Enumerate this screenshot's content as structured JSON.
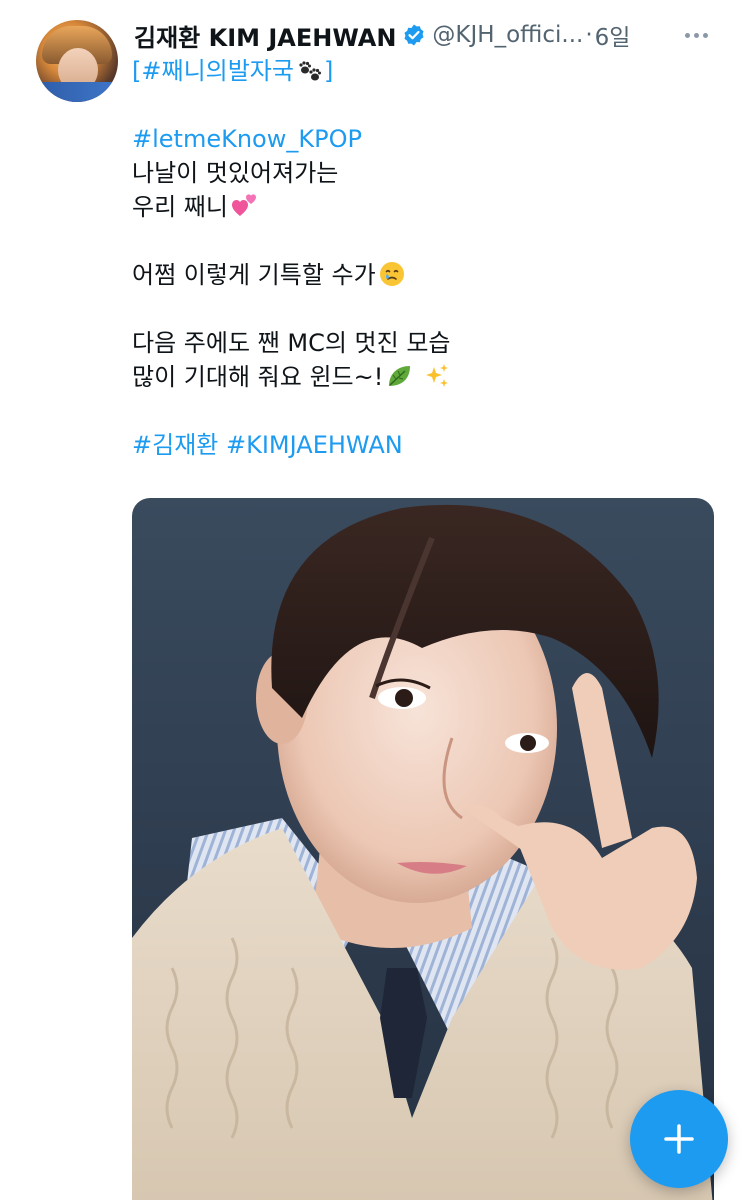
{
  "tweet": {
    "author_name": "김재환 KIM JAEHWAN",
    "handle": "@KJH_offici...",
    "separator": "·",
    "time": "6일",
    "lines": {
      "l1_bracket_open": "[",
      "l1_hashtag": "#째니의발자국",
      "l1_bracket_close": "]",
      "l2_hashtag": "#letmeKnow_KPOP",
      "l3": "나날이 멋있어져가는",
      "l4": "우리 째니",
      "l5": "어쩜 이렇게 기특할 수가",
      "l6": "다음 주에도 짼 MC의 멋진 모습",
      "l7": "많이 기대해 줘요 윈드~!",
      "l8_tag1": "#김재환",
      "l8_tag2": "#KIMJAEHWAN"
    }
  },
  "icons": {
    "verified": "verified-badge-icon",
    "more": "more-options-icon",
    "paw": "paw-prints-icon",
    "hearts": "two-hearts-icon",
    "teary_face": "face-holding-back-tears-icon",
    "leaf": "leaf-icon",
    "sparkles": "sparkles-icon",
    "compose": "plus-icon"
  },
  "colors": {
    "link": "#1d9bf0",
    "text": "#0f1419",
    "secondary": "#536471",
    "fab": "#1d9bf0"
  }
}
